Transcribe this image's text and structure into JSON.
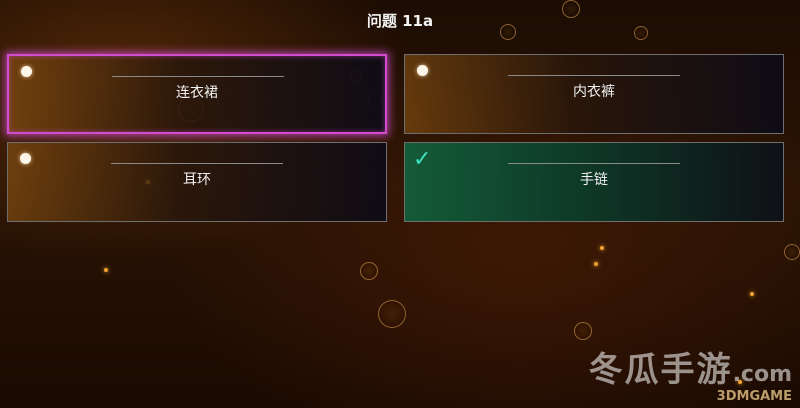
{
  "title": "问题 11a",
  "options": [
    {
      "label": "连衣裙",
      "state": "selected",
      "marker": "radio-dot-icon"
    },
    {
      "label": "内衣裤",
      "state": "normal",
      "marker": "radio-dot-icon"
    },
    {
      "label": "耳环",
      "state": "normal",
      "marker": "radio-dot-icon"
    },
    {
      "label": "手链",
      "state": "correct",
      "marker": "checkmark-icon"
    }
  ],
  "watermark": {
    "brand": "冬瓜手游",
    "domain": ".com",
    "site": "3DMGAME"
  },
  "colors": {
    "selected_border": "#d24cd0",
    "correct_check": "#3fe0c0",
    "correct_bg": "#125f3a"
  }
}
